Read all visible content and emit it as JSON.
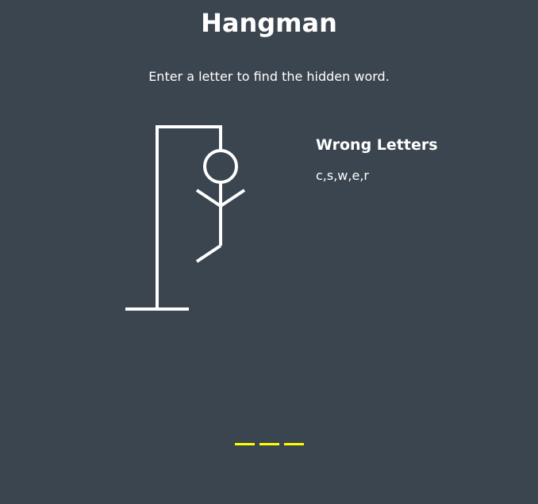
{
  "header": {
    "title": "Hangman"
  },
  "instructions": "Enter a letter to find the hidden word.",
  "wrong_letters": {
    "heading": "Wrong Letters",
    "list": "c,s,w,e,r"
  },
  "word": {
    "letters": [
      "",
      "",
      ""
    ]
  },
  "colors": {
    "background": "#3b4550",
    "text": "#ffffff",
    "word_underline": "#ffff00"
  }
}
